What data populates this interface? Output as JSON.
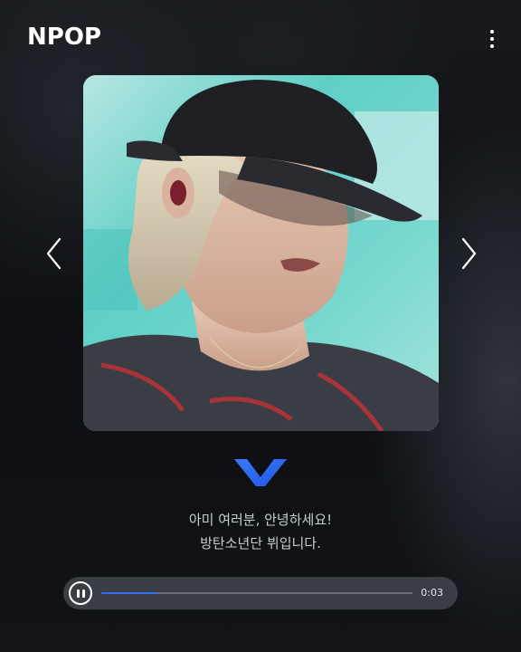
{
  "app": {
    "logo_text": "NPOP"
  },
  "caption": {
    "line1": "아미 여러분, 안녕하세요!",
    "line2": "방탄소년단 뷔입니다."
  },
  "player": {
    "elapsed_time": "0:03",
    "progress": 0.18,
    "state": "playing"
  },
  "icons": {
    "menu": "more-vertical-icon",
    "prev": "chevron-left-icon",
    "next": "chevron-right-icon",
    "brand": "chevron-down-logo-icon",
    "pause": "pause-icon"
  },
  "colors": {
    "accent": "#2f6df3",
    "background": "#0f1116",
    "player_bg": "#3a3d44",
    "text": "#c9ccd2"
  }
}
